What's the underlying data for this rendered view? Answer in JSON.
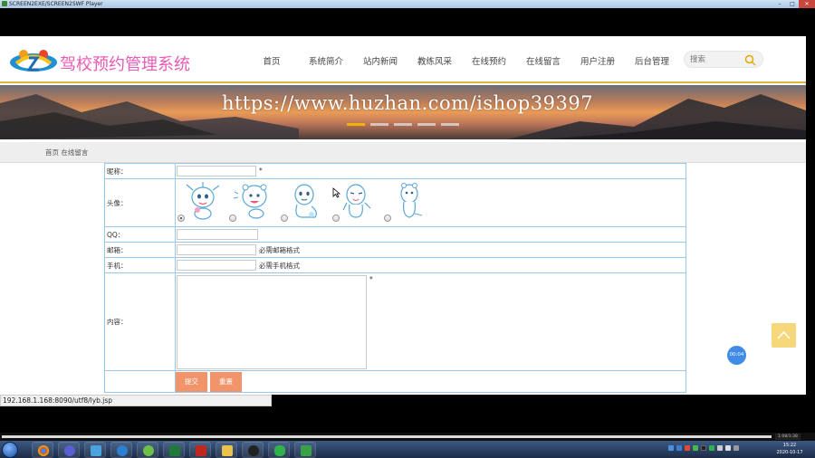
{
  "window": {
    "title": "SCREEN2EXE/SCREEN2SWF Player"
  },
  "site": {
    "title": "驾校预约管理系统",
    "nav": [
      "首页",
      "系统简介",
      "站内新闻",
      "教练风采",
      "在线预约",
      "在线留言",
      "用户注册",
      "后台管理"
    ],
    "search_placeholder": "搜索",
    "watermark": "https://www.huzhan.com/ishop39397",
    "breadcrumb": "首页 在线留言",
    "colors": {
      "logo_text": "#e95ab6",
      "accent": "#d9b63c",
      "button": "#f2946a",
      "table_border": "#9ac7e8"
    }
  },
  "form": {
    "nickname_label": "昵称：",
    "required_mark": "*",
    "avatar_label": "头像：",
    "avatar_selected_index": 0,
    "qq_label": "QQ：",
    "email_label": "邮箱：",
    "email_hint": "必需邮箱格式",
    "phone_label": "手机：",
    "phone_hint": "必需手机格式",
    "content_label": "内容：",
    "content_required": "*",
    "submit_label": "提交",
    "reset_label": "重置"
  },
  "status": {
    "url": "192.168.1.168:8090/utf8/lyb.jsp",
    "timer": "00:04"
  },
  "taskbar": {
    "time": "15:22",
    "date": "2020-10-17",
    "player_time": "1:08/1:38"
  }
}
